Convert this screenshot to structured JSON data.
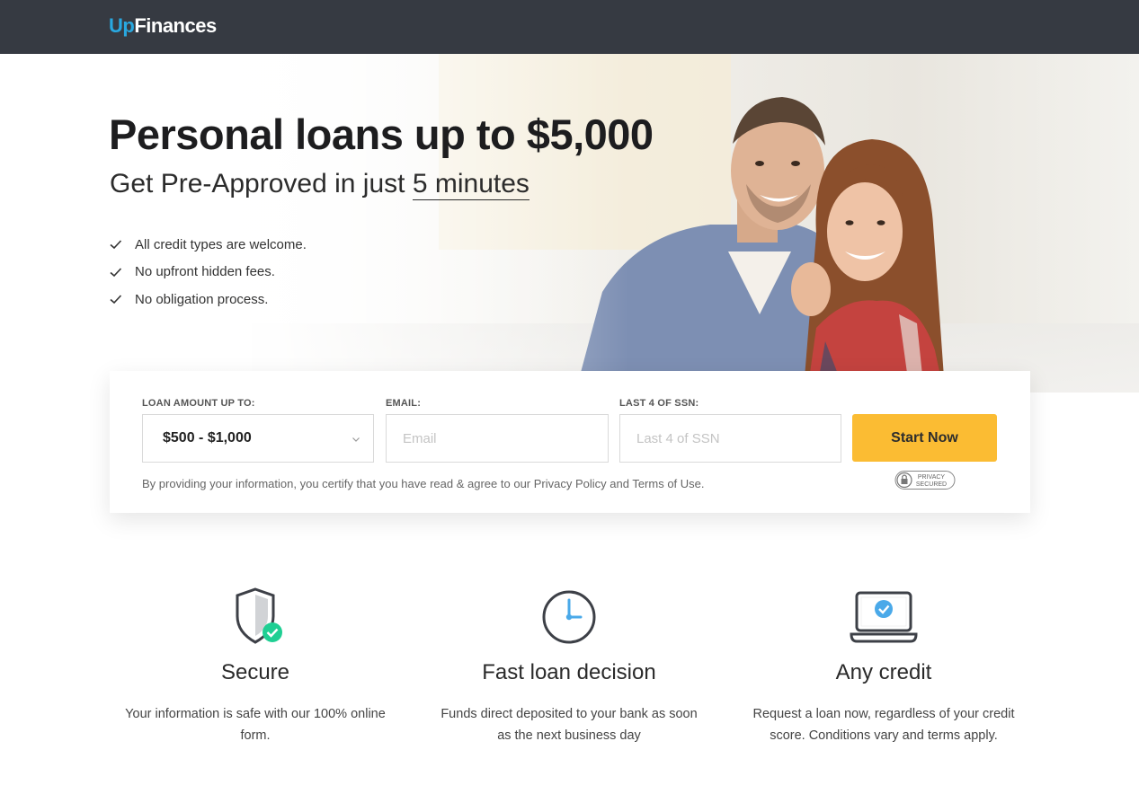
{
  "brand": {
    "logo_prefix": "Up",
    "logo_suffix": "Finances",
    "accent": "#29a8e0"
  },
  "hero": {
    "headline": "Personal loans up to $5,000",
    "subhead_prefix": "Get Pre-Approved in just ",
    "subhead_emphasis": "5 minutes",
    "checklist": [
      "All credit types are welcome.",
      "No upfront hidden fees.",
      "No obligation process."
    ]
  },
  "form": {
    "amount_label": "LOAN AMOUNT UP TO:",
    "amount_value": "$500 - $1,000",
    "email_label": "EMAIL:",
    "email_placeholder": "Email",
    "ssn_label": "LAST 4 OF SSN:",
    "ssn_placeholder": "Last 4 of SSN",
    "submit_label": "Start Now",
    "submit_color": "#fbbc33",
    "disclaimer": "By providing your information, you certify that you have read & agree to our Privacy Policy and Terms of Use.",
    "privacy_badge_line1": "PRIVACY",
    "privacy_badge_line2": "SECURED"
  },
  "features": [
    {
      "icon": "shield-check-icon",
      "title": "Secure",
      "text": "Your information is safe with our 100% online form."
    },
    {
      "icon": "clock-icon",
      "title": "Fast loan decision",
      "text": "Funds direct deposited to your bank as soon as the next business day"
    },
    {
      "icon": "laptop-check-icon",
      "title": "Any credit",
      "text": "Request a loan now, regardless of your credit score. Conditions vary and terms apply."
    }
  ]
}
